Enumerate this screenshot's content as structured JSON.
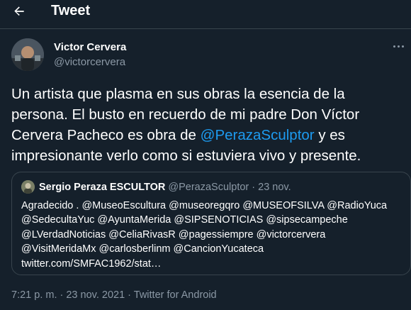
{
  "header": {
    "title": "Tweet"
  },
  "author": {
    "name": "Victor Cervera",
    "handle": "@victorcervera"
  },
  "tweet": {
    "text_before": "Un artista que plasma en sus obras la esencia de la\npersona. El busto en recuerdo de mi padre Don Víctor\nCervera Pacheco es obra de ",
    "mention": "@PerazaSculptor",
    "text_after": " y es\nimpresionante verlo como si estuviera vivo y presente."
  },
  "quote": {
    "name": "Sergio Peraza ESCULTOR",
    "handle": "@PerazaSculptor",
    "sep": " · ",
    "date": "23 nov.",
    "body": "Agradecido . @MuseoEscultura @museoregqro @MUSEOFSILVA @RadioYuca\n@SedecultaYuc @AyuntaMerida @SIPSENOTICIAS @sipsecampeche\n@LVerdadNoticias @CeliaRivasR @pagessiempre @victorcervera\n@VisitMeridaMx @carlosberlinm @CancionYucateca\ntwitter.com/SMFAC1962/stat…"
  },
  "meta": {
    "text": "7:21 p. m. · 23 nov. 2021 · Twitter for Android"
  },
  "colors": {
    "background": "#15202b",
    "accent": "#1d9bf0",
    "muted": "#8b98a5",
    "border": "#38444d"
  },
  "icons": {
    "back": "arrow-left-icon",
    "more": "more-horizontal-icon"
  }
}
